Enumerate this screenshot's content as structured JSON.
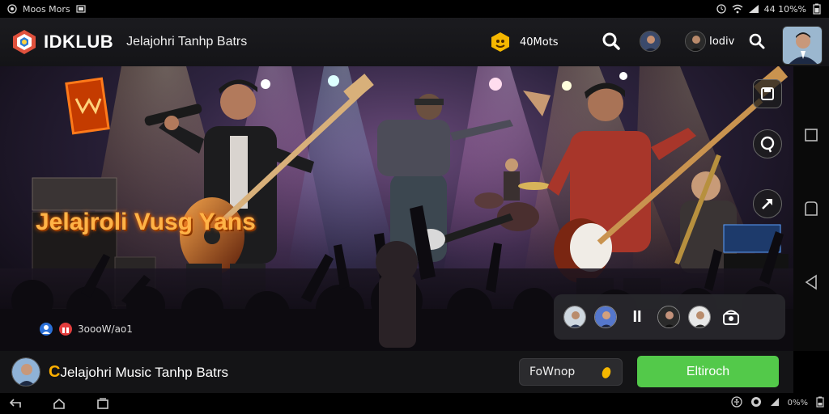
{
  "status_bar": {
    "left_text": "Moos Mors",
    "right_text": "44 10%%"
  },
  "app_bar": {
    "brand": "IDKLUB",
    "title": "Jelajohri Tanhp Batrs",
    "coins": "40Mots",
    "user_label": "Iodiv"
  },
  "stage": {
    "headline": "Jelajroli Vusg Yans",
    "listeners": "3oooW/ao1"
  },
  "call_panel": {
    "pause_label": "II"
  },
  "bottom_bar": {
    "title_prefix": "C",
    "title": "Jelajohri Music Tanhp Batrs",
    "follow_label": "FoWnop",
    "join_label": "Eltiroch"
  },
  "sys_nav": {
    "right_text": "0%%"
  },
  "colors": {
    "accent_green": "#53c94a",
    "headline_orange": "#ffb347",
    "coin_gold": "#f5b700"
  }
}
